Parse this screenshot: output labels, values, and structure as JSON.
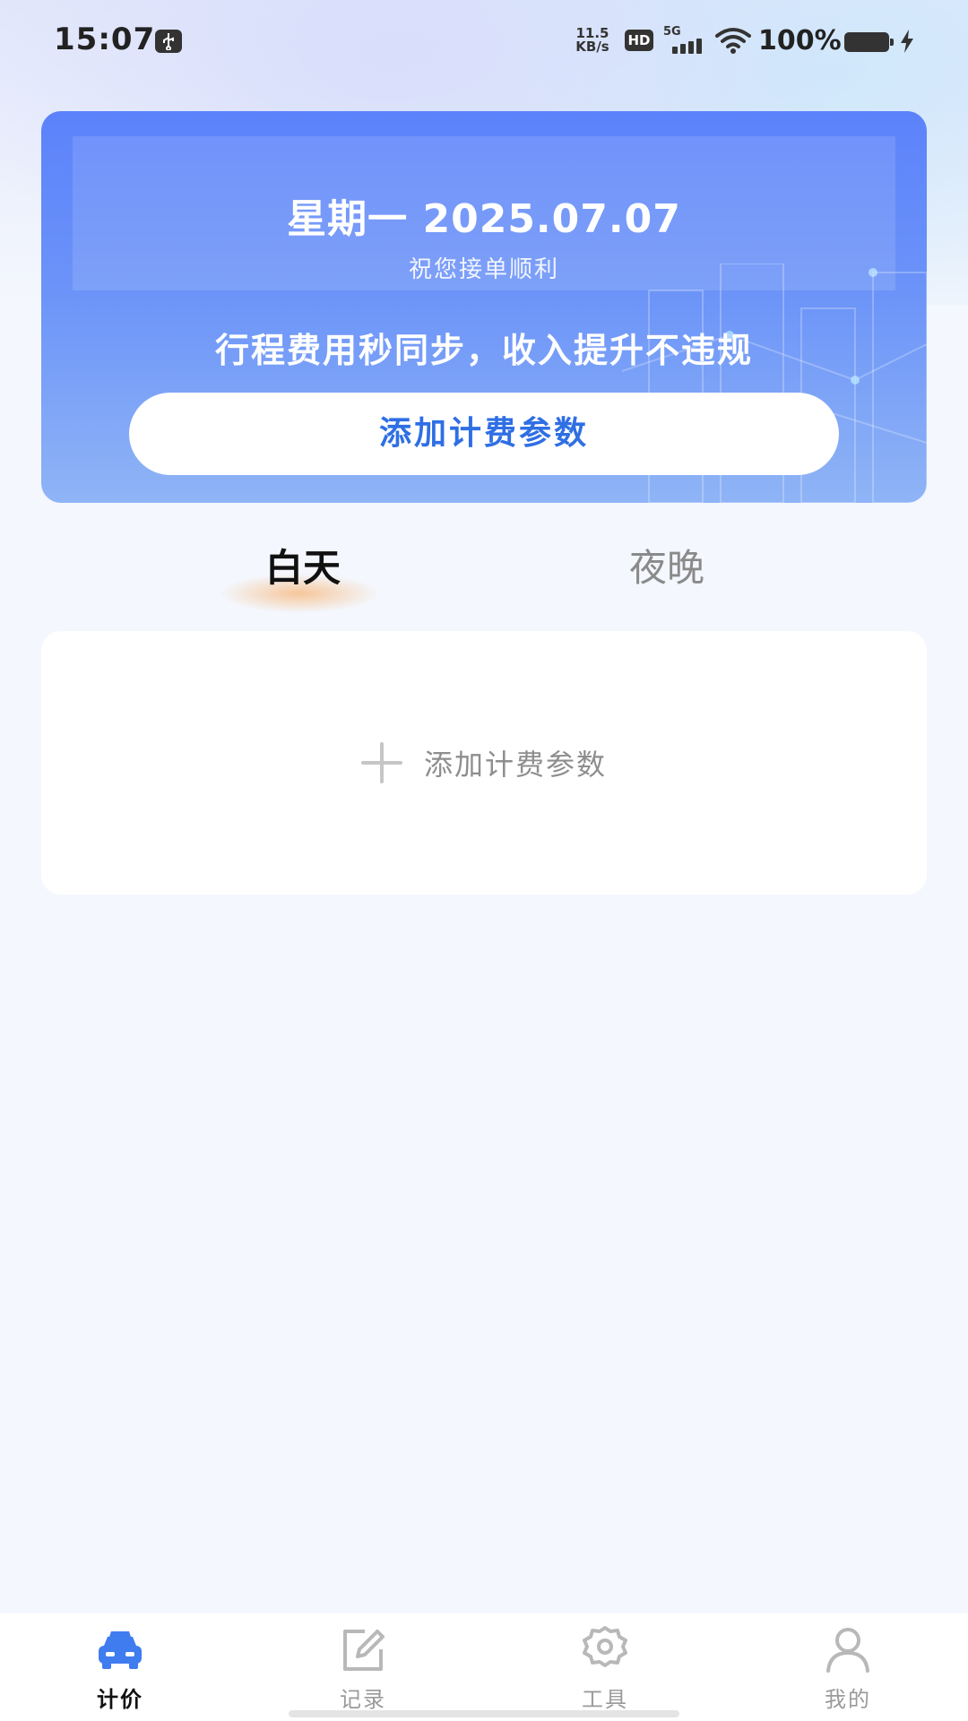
{
  "status_bar": {
    "time": "15:07",
    "net_speed_value": "11.5",
    "net_speed_unit": "KB/s",
    "hd": "HD",
    "network": "5G",
    "battery": "100%"
  },
  "hero": {
    "date": "星期一 2025.07.07",
    "wish": "祝您接单顺利",
    "slogan": "行程费用秒同步，收入提升不违规",
    "button_label": "添加计费参数"
  },
  "tabs": [
    {
      "label": "白天",
      "active": true
    },
    {
      "label": "夜晚",
      "active": false
    }
  ],
  "content": {
    "add_label": "添加计费参数"
  },
  "bottom_nav": [
    {
      "label": "计价",
      "icon": "taxi-icon",
      "active": true
    },
    {
      "label": "记录",
      "icon": "edit-icon",
      "active": false
    },
    {
      "label": "工具",
      "icon": "gear-icon",
      "active": false
    },
    {
      "label": "我的",
      "icon": "user-icon",
      "active": false
    }
  ],
  "colors": {
    "accent": "#2f6fe4",
    "hero_top": "#5c82fb",
    "hero_bottom": "#8fb4f6",
    "tab_indicator": "#f7b678"
  }
}
